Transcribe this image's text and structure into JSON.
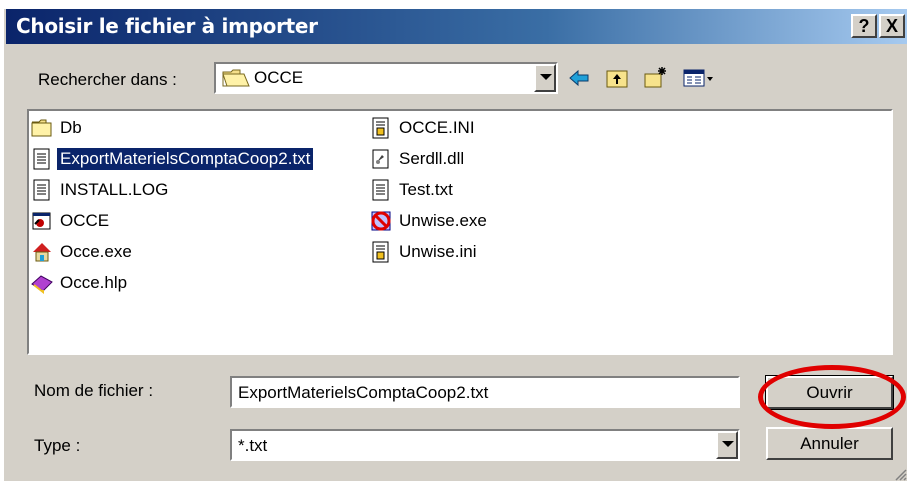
{
  "window": {
    "title": "Choisir le fichier à importer",
    "help_label": "?",
    "close_label": "X"
  },
  "lookin": {
    "label": "Rechercher dans :",
    "value": "OCCE"
  },
  "toolbar": {
    "icons": [
      "back-arrow-icon",
      "up-folder-icon",
      "new-folder-icon",
      "view-menu-icon"
    ]
  },
  "files": [
    {
      "name": "Db",
      "icon": "folder-icon"
    },
    {
      "name": "ExportMaterielsComptaCoop2.txt",
      "icon": "text-file-icon",
      "selected": true
    },
    {
      "name": "INSTALL.LOG",
      "icon": "text-file-icon"
    },
    {
      "name": "OCCE",
      "icon": "app-shortcut-icon"
    },
    {
      "name": "Occe.exe",
      "icon": "house-app-icon"
    },
    {
      "name": "Occe.hlp",
      "icon": "help-book-icon"
    },
    {
      "name": "OCCE.INI",
      "icon": "ini-file-icon"
    },
    {
      "name": "Serdll.dll",
      "icon": "dll-file-icon"
    },
    {
      "name": "Test.txt",
      "icon": "text-file-icon"
    },
    {
      "name": "Unwise.exe",
      "icon": "uninstall-app-icon"
    },
    {
      "name": "Unwise.ini",
      "icon": "ini-file-icon"
    }
  ],
  "filename": {
    "label": "Nom de fichier :",
    "value": "ExportMaterielsComptaCoop2.txt"
  },
  "filetype": {
    "label": "Type :",
    "value": "*.txt"
  },
  "buttons": {
    "open": "Ouvrir",
    "cancel": "Annuler"
  },
  "colors": {
    "selection": "#0a246a",
    "highlight_ring": "#e00000",
    "dialog_face": "#d4d0c8"
  }
}
